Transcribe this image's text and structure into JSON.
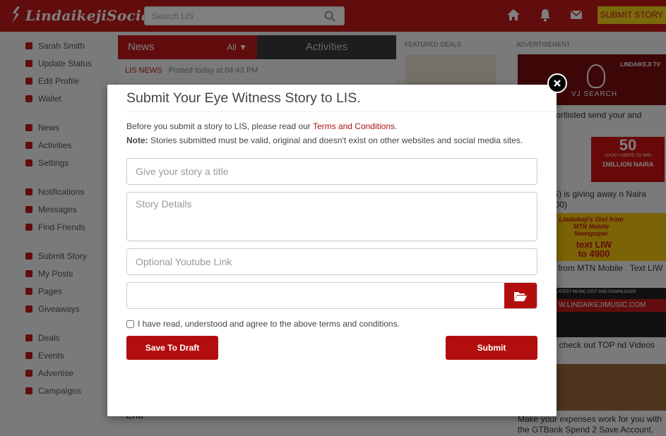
{
  "header": {
    "logo_text": "LindaikejiSocial",
    "search_placeholder": "Search LIS",
    "submit_story_label": "SUBMIT STORY"
  },
  "sidebar": {
    "groups": [
      [
        {
          "label": "Sarah Smith",
          "icon": "user-icon"
        },
        {
          "label": "Update Status",
          "icon": "edit-icon"
        },
        {
          "label": "Edit Profile",
          "icon": "pencil-icon"
        },
        {
          "label": "Wallet",
          "icon": "wallet-icon"
        }
      ],
      [
        {
          "label": "News",
          "icon": "news-icon"
        },
        {
          "label": "Activities",
          "icon": "list-icon"
        },
        {
          "label": "Settings",
          "icon": "gear-icon"
        }
      ],
      [
        {
          "label": "Notifications",
          "icon": "bell-icon"
        },
        {
          "label": "Messages",
          "icon": "envelope-icon"
        },
        {
          "label": "Find Friends",
          "icon": "search-icon"
        }
      ],
      [
        {
          "label": "Submit Story",
          "icon": "upload-icon"
        },
        {
          "label": "My Posts",
          "icon": "copy-icon"
        },
        {
          "label": "Pages",
          "icon": "copy-icon"
        },
        {
          "label": "Giveaways",
          "icon": "gift-icon"
        }
      ],
      [
        {
          "label": "Deals",
          "icon": "cart-icon"
        },
        {
          "label": "Events",
          "icon": "calendar-icon"
        },
        {
          "label": "Advertise",
          "icon": "bullhorn-icon"
        },
        {
          "label": "Campaigns",
          "icon": "image-icon"
        }
      ]
    ]
  },
  "feed": {
    "tab_news": "News",
    "tab_filter": "All",
    "tab_activities": "Activities",
    "source": "LIS NEWS",
    "posted": "Posted today at 04:43 PM",
    "end_text": "End"
  },
  "deals": {
    "heading": "FEATURED DEALS"
  },
  "ads": {
    "heading": "ADVERTISEMENT",
    "ad1_brand": "LINDAIKEJI TV",
    "ad1_search": "VJ SEARCH",
    "ad1_text": "eo was shortlisted send your and email.",
    "ad2_big": "50",
    "ad2_small": "LUCKY USERS TO WIN",
    "ad2_million": "1MILLION NAIRA",
    "ad2_text": "Social (LIS) is giving away n Naira (N1,000,000)",
    "ad3_text_a": "Lindaikeji's Gist from MTN Mobile Newspaper",
    "ad3_text_b": "text LIW to 4900",
    "ad3_text": "lkeji's Gist from MTN Mobile . Text LIW to 4900",
    "ad4_small": "LATEST MUSIC GIST AND DOWNLOADS",
    "ad4_url": "W.LINDAIKEJIMUSIC.COM",
    "ad4_text": "ll moment, check out TOP nd Videos",
    "ad5_text": "Make your expenses work for you with the GTBank Spend 2 Save Account."
  },
  "modal": {
    "title": "Submit Your Eye Witness Story to LIS.",
    "intro_prefix": "Before you submit a story to LIS, please read our ",
    "terms_link": "Terms and Conditions",
    "intro_suffix": ".",
    "note_label": "Note:",
    "note_text": " Stories submitted must be valid, original and doesn't exist on other websites and social media sites.",
    "title_placeholder": "Give your story a title",
    "details_placeholder": "Story Details",
    "youtube_placeholder": "Optional Youtube Link",
    "agree_text": "I have read, understood and agree to the above terms and conditions.",
    "draft_label": "Save To Draft",
    "submit_label": "Submit"
  },
  "colors": {
    "brand_red": "#c31a1a",
    "button_red": "#b20e0e",
    "accent_yellow": "#f7d21a"
  }
}
